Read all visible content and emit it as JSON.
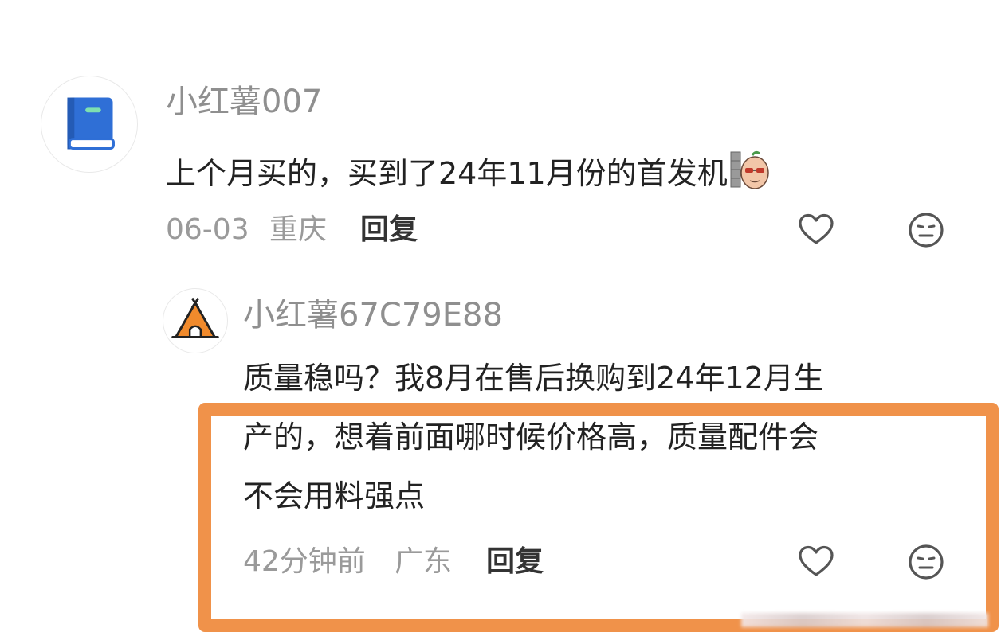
{
  "comments": [
    {
      "username": "小红薯007",
      "avatar_icon": "book-icon",
      "content": "上个月买的，买到了24年11月份的首发机",
      "sticker_icon": "sticker-icon",
      "time": "06-03",
      "location": "重庆",
      "reply_label": "回复"
    },
    {
      "username": "小红薯67C79E88",
      "avatar_icon": "tent-icon",
      "content_lines": [
        "质量稳吗？我8月在售后换购到24年12月生",
        "产的，想着前面哪时候价格高，质量配件会",
        "不会用料强点"
      ],
      "time": "42分钟前",
      "location": "广东",
      "reply_label": "回复"
    }
  ],
  "colors": {
    "highlight_border": "#f0924a",
    "username": "#8f8f8f",
    "meta": "#9a9a9a"
  }
}
